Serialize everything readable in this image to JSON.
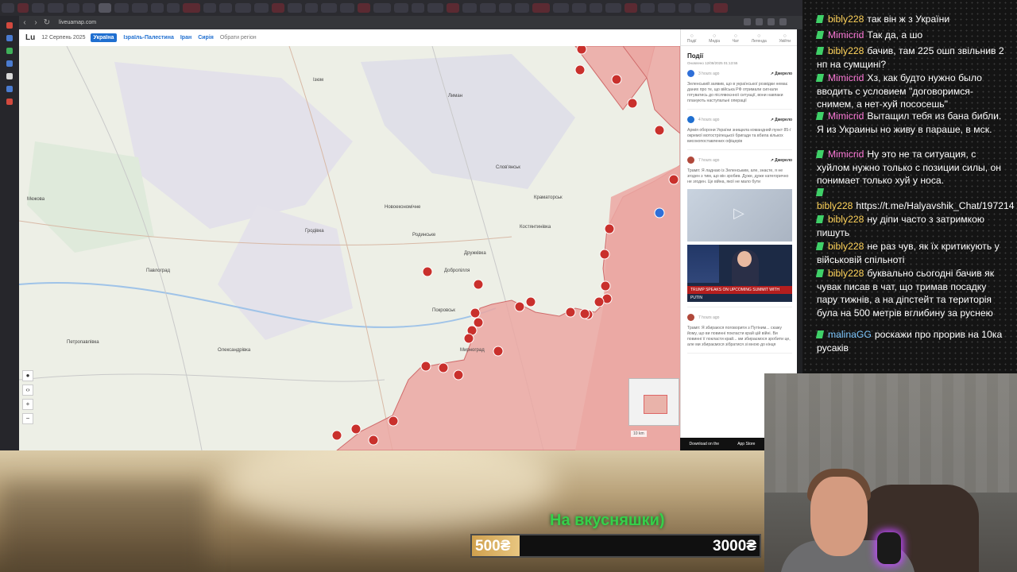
{
  "browser": {
    "url": "liveuamap.com"
  },
  "site": {
    "logo": "Lu",
    "date": "12 Серпень 2025",
    "nav": [
      "Україна",
      "Ізраїль-Палестина",
      "Іран",
      "Сирія"
    ],
    "region_picker": "Обрати регіон"
  },
  "sidebar": {
    "tabs": [
      "Події",
      "Медіа",
      "Чат",
      "Легенда",
      "Увійти"
    ],
    "title": "Події",
    "updated": "Оновлено 12/08/2025 01:13:55",
    "events": [
      {
        "time": "3 hours ago",
        "source": "Джерело",
        "icon_color": "#2f6fd8",
        "text": "Зеленський заявив, що в української розвідки немає даних про те, що війська РФ отримали сигнали готуватись до післявоєнної ситуації, вони навпаки планують наступальні операції"
      },
      {
        "time": "4 hours ago",
        "source": "Джерело",
        "icon_color": "#1f6fd0",
        "text": "Армія оборони України знищила командний пункт 85-ї окремої мотострілецької бригади та вбила кількох високопоставлених офіцерів"
      },
      {
        "time": "7 hours ago",
        "source": "Джерело",
        "icon_color": "#b0483a",
        "text": "Трамп: Я ладнаю із Зеленським, але, знаєте, я не згоден з тим, що він зробив. Дуже, дуже категорично не згоден. Це війна, якої не мало бути"
      },
      {
        "time": "7 hours ago",
        "source": "",
        "icon_color": "#b0483a",
        "text": "Трамп: Я збираюся поговорити з Путіним... скажу йому, що ви повинні покласти край цій війні. Ви повинні її покласти край... ми збираємося зробити це, але ми збираємося зібратися зі мною до кінця"
      }
    ],
    "news_ticker": "TRUMP SPEAKS ON UPCOMING SUMMIT WITH PUTIN",
    "appbar": [
      "Download on the",
      "App Store"
    ]
  },
  "map": {
    "labels": [
      "Краматорськ",
      "Костянтинівка",
      "Покровськ",
      "Добропілля",
      "Павлоград",
      "Ізюм",
      "Лиман",
      "Слов'янськ",
      "Дружківка",
      "Родинське",
      "Мирноград",
      "Новоекономічне",
      "Гродівка",
      "Межова",
      "Петропавлівка",
      "Олександрівка"
    ],
    "controls": [
      "●",
      "‹›",
      "+",
      "−"
    ],
    "scale": "10 km",
    "occupied_color": "#eba7a2"
  },
  "chat": {
    "messages": [
      {
        "user": "bibly228",
        "text": "так він ж з України"
      },
      {
        "user": "Mimicrid",
        "text": "Так да, а шо"
      },
      {
        "user": "bibly228",
        "text": "бачив, там 225 ошп звільнив 2 нп на сумщині?"
      },
      {
        "user": "Mimicrid",
        "text": "Хз, как будто нужно было вводить с условием \"договоримся-снимем, а нет-хуй пососешь\""
      },
      {
        "user": "Mimicrid",
        "text": "Вытащил тебя из бана библи. Я из Украины но живу в параше, в мск."
      },
      {
        "user": "Mimicrid",
        "text": "Ну это не та ситуация, с хуйлом нужно только с позиции силы, он понимает только хуй у носа."
      },
      {
        "user": "bibly228",
        "text": "https://t.me/Halyavshik_Chat/197214"
      },
      {
        "user": "bibly228",
        "text": "ну діпи часто з затримкою пишуть"
      },
      {
        "user": "bibly228",
        "text": "не раз чув, як їх критикують у військовій спільноті"
      },
      {
        "user": "bibly228",
        "text": "буквально сьогодні бачив як чувак писав в чат, що тримав посадку пару тижнів, а на діпстейт та територія була на 500 метрів вглибину за руснею"
      },
      {
        "user": "malinaGG",
        "text": "роскажи про прорив на 10ка русаків"
      }
    ]
  },
  "donation": {
    "label": "На вкусняшки)",
    "current": "500₴",
    "goal": "3000₴",
    "progress": 0.167,
    "color": "#36d04a"
  }
}
